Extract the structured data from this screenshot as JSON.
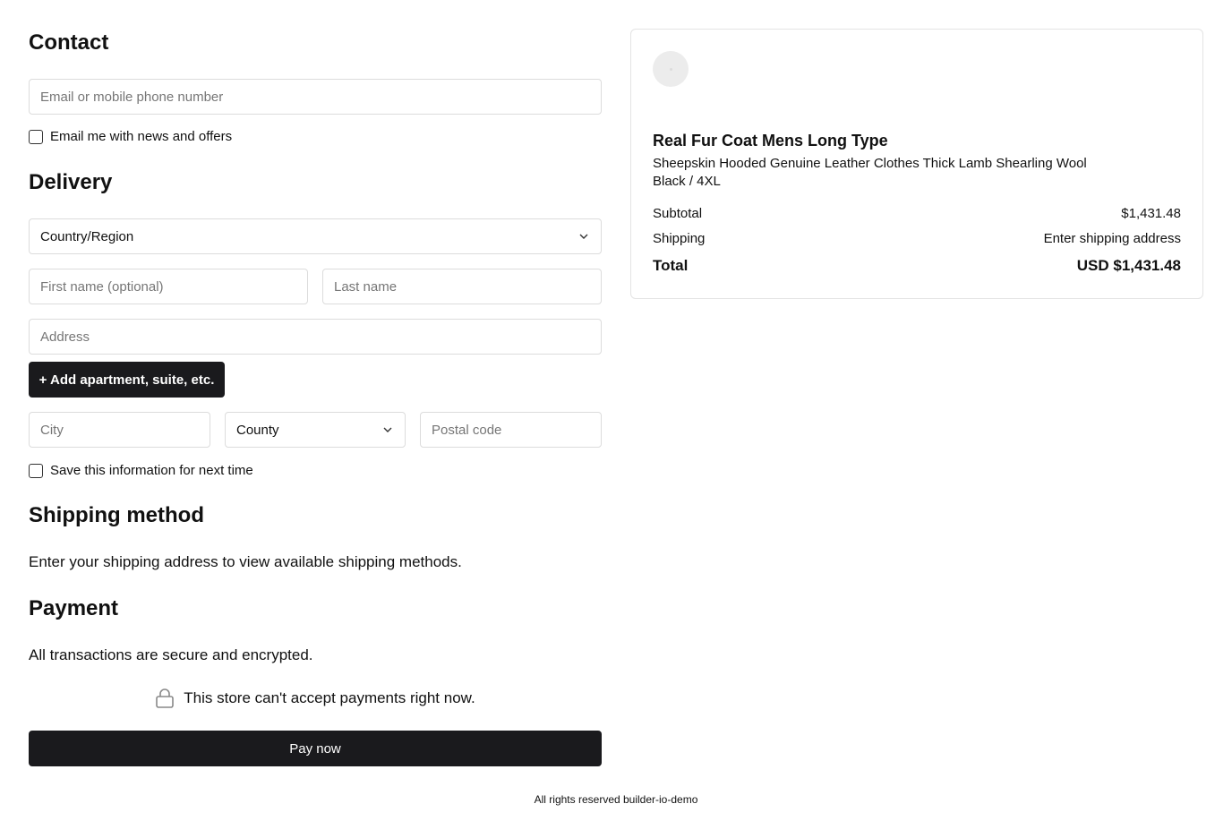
{
  "contact": {
    "heading": "Contact",
    "email_placeholder": "Email or mobile phone number",
    "newsletter_label": "Email me with news and offers"
  },
  "delivery": {
    "heading": "Delivery",
    "country_value": "Country/Region",
    "first_name_placeholder": "First name (optional)",
    "last_name_placeholder": "Last name",
    "address_placeholder": "Address",
    "add_apartment_label": "+ Add apartment, suite, etc.",
    "city_placeholder": "City",
    "county_value": "County",
    "postal_placeholder": "Postal code",
    "save_info_label": "Save this information for next time"
  },
  "shipping_method": {
    "heading": "Shipping method",
    "message": "Enter your shipping address to view available shipping methods."
  },
  "payment": {
    "heading": "Payment",
    "secure_note": "All transactions are secure and encrypted.",
    "unavailable_note": "This store can't accept payments right now.",
    "pay_label": "Pay now"
  },
  "summary": {
    "product_title": "Real Fur Coat Mens Long Type",
    "product_description": "Sheepskin Hooded Genuine Leather Clothes Thick Lamb Shearling Wool",
    "product_variant": "Black / 4XL",
    "subtotal_label": "Subtotal",
    "subtotal_value": "$1,431.48",
    "shipping_label": "Shipping",
    "shipping_value": "Enter shipping address",
    "total_label": "Total",
    "total_value": "USD $1,431.48"
  },
  "footer": {
    "text": "All rights reserved builder-io-demo"
  },
  "icons": {
    "chevron": "chevron-down-icon",
    "lock": "lock-icon"
  },
  "colors": {
    "button_bg": "#1a1a1d",
    "border": "#dcdcdc"
  }
}
